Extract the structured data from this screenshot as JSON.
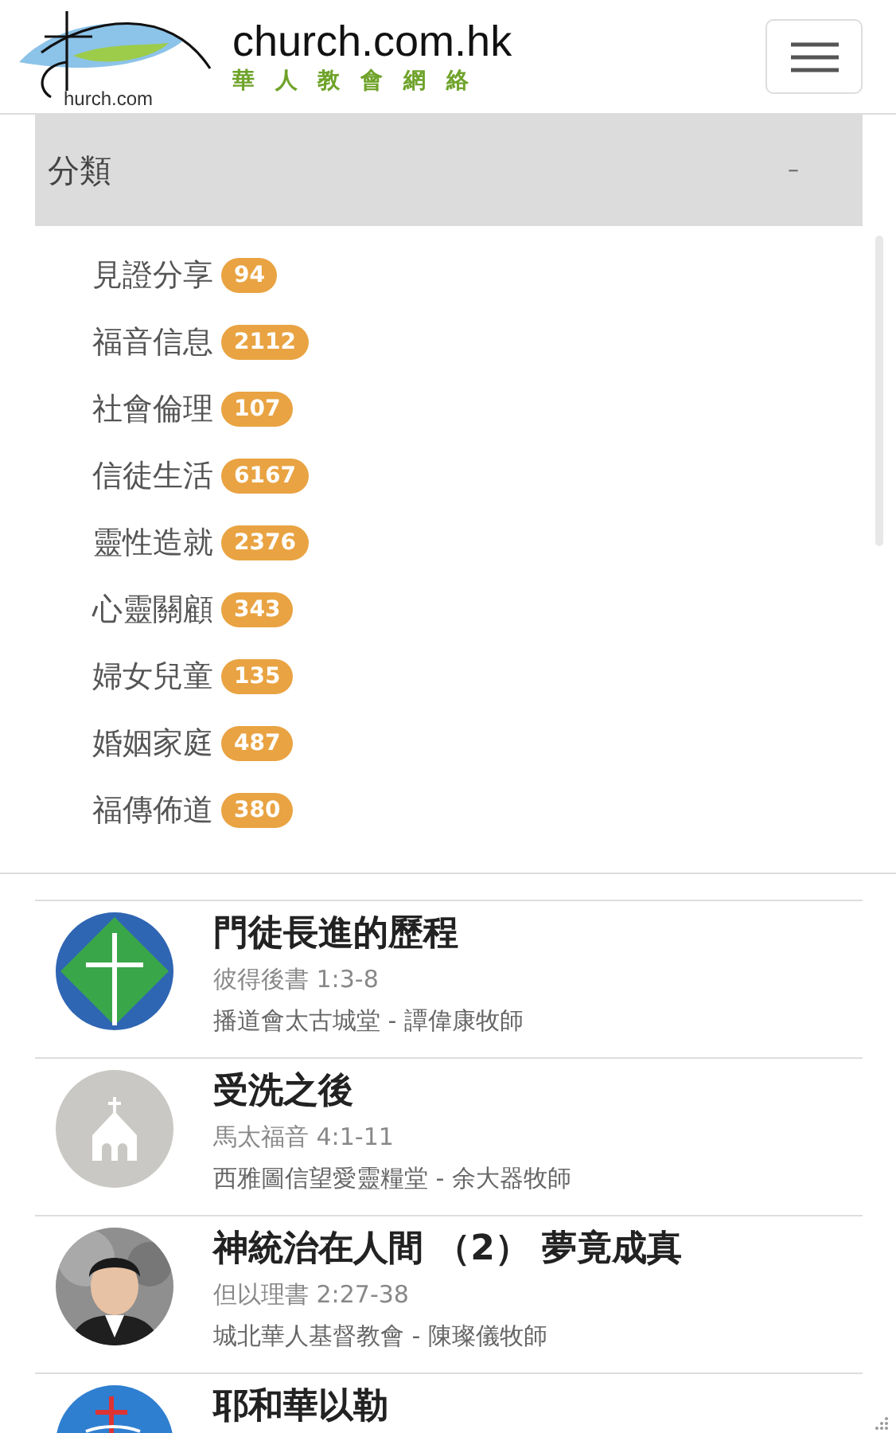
{
  "header": {
    "logo_caption": "hurch.com",
    "site_name": "church.com.hk",
    "site_subtitle": "華 人 教 會 網 絡"
  },
  "categories": {
    "title": "分類",
    "toggle": "–",
    "items": [
      {
        "label": "見證分享",
        "count": "94"
      },
      {
        "label": "福音信息",
        "count": "2112"
      },
      {
        "label": "社會倫理",
        "count": "107"
      },
      {
        "label": "信徒生活",
        "count": "6167"
      },
      {
        "label": "靈性造就",
        "count": "2376"
      },
      {
        "label": "心靈關顧",
        "count": "343"
      },
      {
        "label": "婦女兒童",
        "count": "135"
      },
      {
        "label": "婚姻家庭",
        "count": "487"
      },
      {
        "label": "福傳佈道",
        "count": "380"
      }
    ]
  },
  "sermons": [
    {
      "kind": "cross",
      "title": "門徒長進的歷程",
      "reference": "彼得後書 1:3-8",
      "church": "播道會太古城堂 - 譚偉康牧師"
    },
    {
      "kind": "chapel",
      "title": "受洗之後",
      "reference": "馬太福音 4:1-11",
      "church": "西雅圖信望愛靈糧堂 - 余大器牧師"
    },
    {
      "kind": "picture",
      "title": "神統治在人間 （2） 夢竟成真",
      "reference": "但以理書 2:27-38",
      "church": "城北華人基督教會 - 陳璨儀牧師"
    },
    {
      "kind": "emblem",
      "title": "耶和華以勒"
    }
  ]
}
